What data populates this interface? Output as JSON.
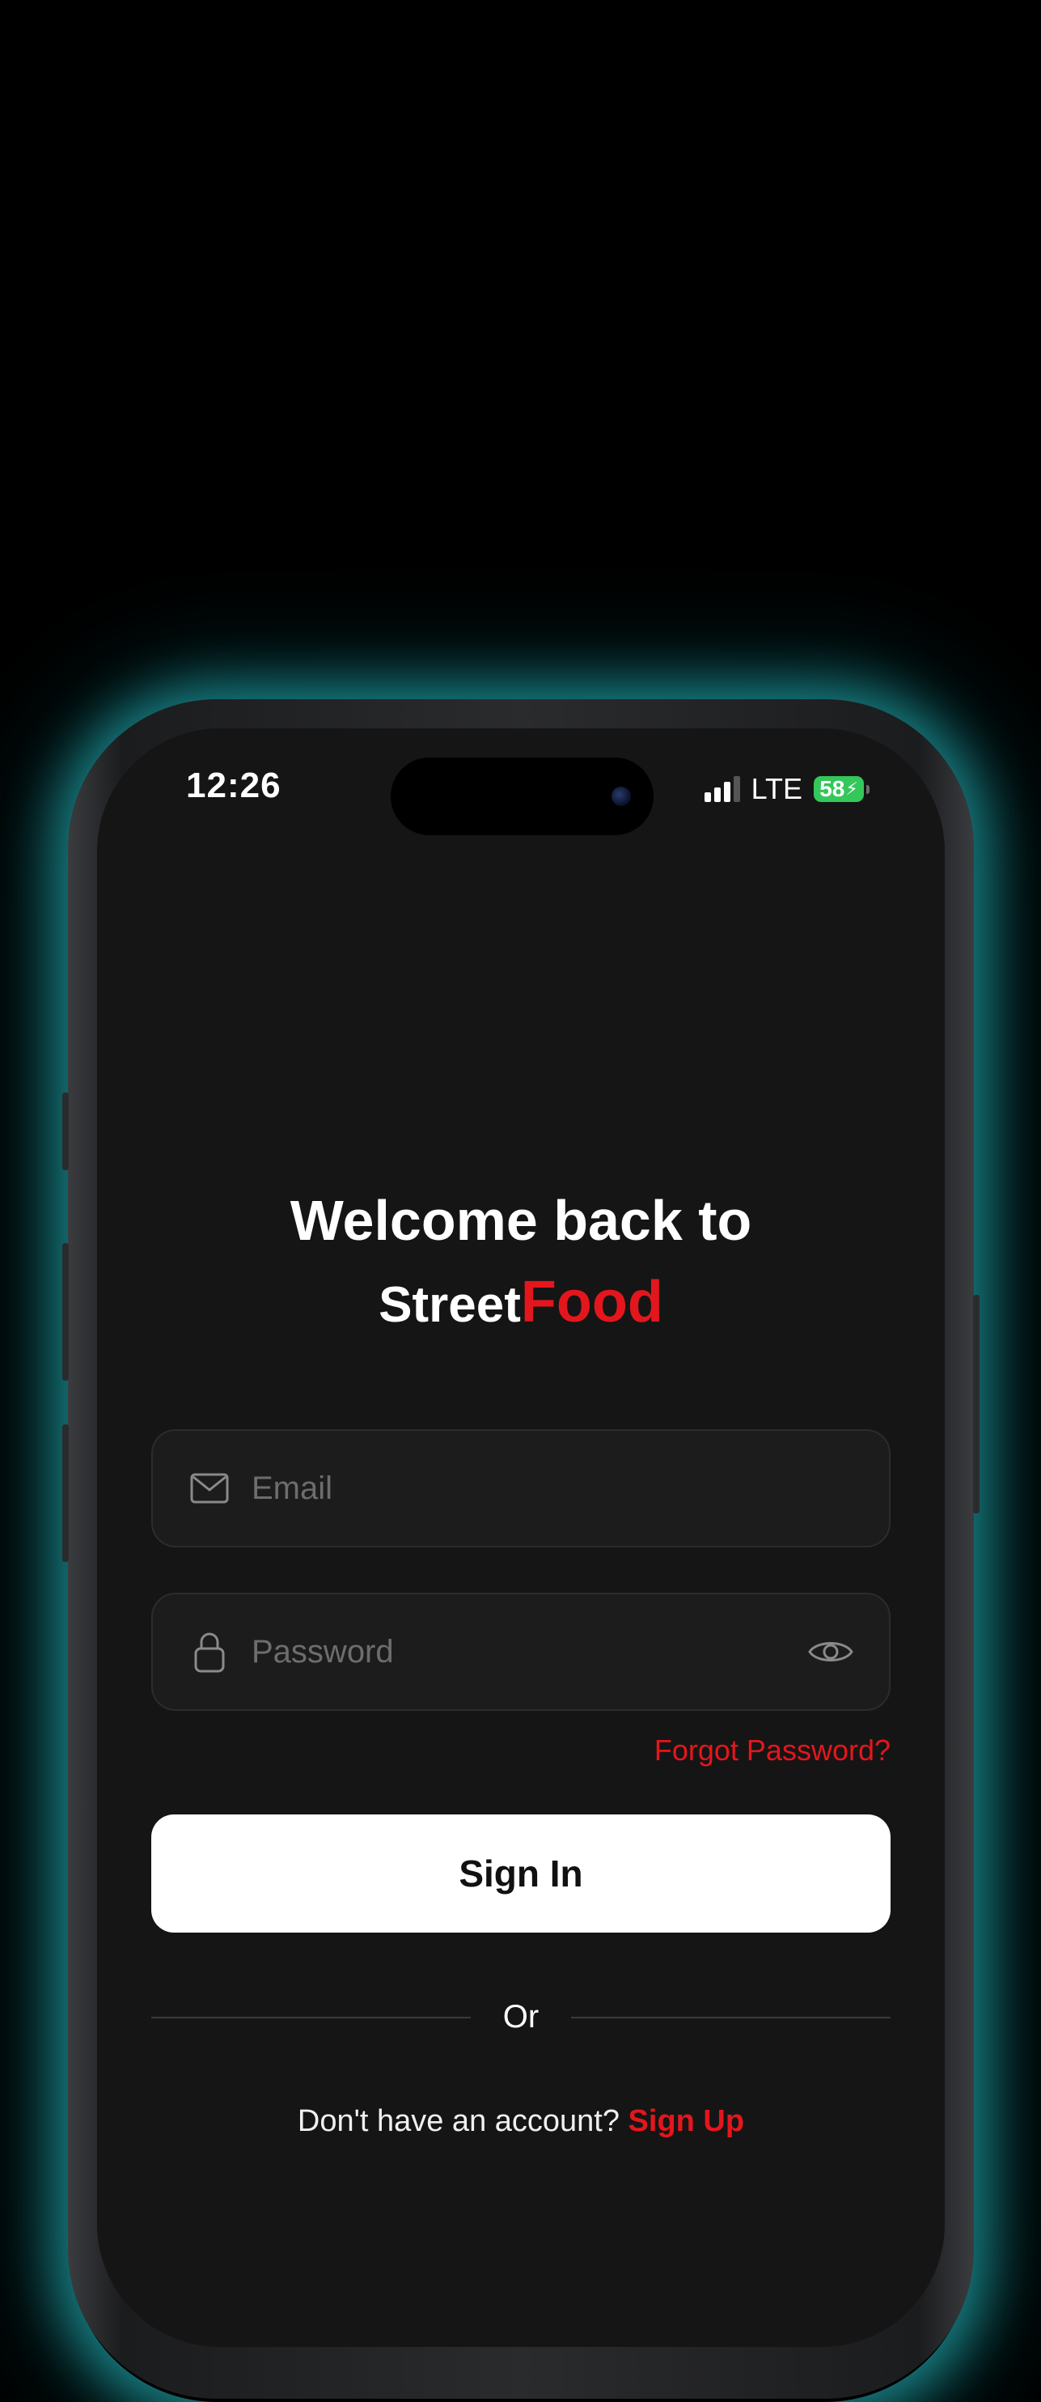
{
  "status_bar": {
    "time": "12:26",
    "network": "LTE",
    "battery": "58",
    "battery_color": "#34c759"
  },
  "header": {
    "title": "Welcome back to",
    "brand_part1": "Street",
    "brand_part2": "Food",
    "brand_accent_color": "#e4161d"
  },
  "form": {
    "email": {
      "placeholder": "Email",
      "value": "",
      "icon": "mail-icon"
    },
    "password": {
      "placeholder": "Password",
      "value": "",
      "icon": "lock-icon",
      "toggle_icon": "eye-icon"
    },
    "forgot_label": "Forgot Password?",
    "signin_label": "Sign In"
  },
  "divider": {
    "label": "Or"
  },
  "footer": {
    "prompt": "Don't have an account?",
    "signup_label": "Sign Up"
  },
  "colors": {
    "background": "#000000",
    "screen": "#151515",
    "accent": "#e4161d",
    "glow": "#28c8cd"
  }
}
